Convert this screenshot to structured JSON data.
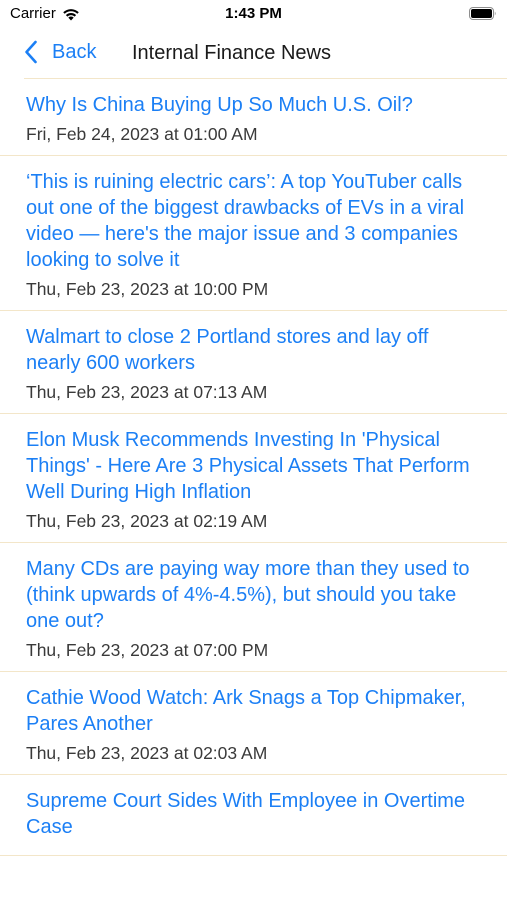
{
  "status_bar": {
    "carrier": "Carrier",
    "time": "1:43 PM"
  },
  "nav": {
    "back_label": "Back",
    "title": "Internal Finance News"
  },
  "colors": {
    "link": "#1b7ff5",
    "divider": "#f3e6c9"
  },
  "news": [
    {
      "title": "Why Is China Buying Up So Much U.S. Oil?",
      "date": "Fri, Feb 24, 2023 at 01:00 AM"
    },
    {
      "title": "‘This is ruining electric cars’: A top YouTuber calls out one of the biggest drawbacks of EVs in a viral video — here's the major issue and 3 companies looking to solve it",
      "date": "Thu, Feb 23, 2023 at 10:00 PM"
    },
    {
      "title": "Walmart to close 2 Portland stores and lay off nearly 600 workers",
      "date": "Thu, Feb 23, 2023 at 07:13 AM"
    },
    {
      "title": "Elon Musk Recommends Investing In 'Physical Things' - Here Are 3 Physical Assets That Perform Well During High Inflation",
      "date": "Thu, Feb 23, 2023 at 02:19 AM"
    },
    {
      "title": "Many CDs are paying way more than they used to (think upwards of 4%-4.5%), but should you take one out?",
      "date": "Thu, Feb 23, 2023 at 07:00 PM"
    },
    {
      "title": "Cathie Wood Watch: Ark Snags a Top Chipmaker, Pares Another",
      "date": "Thu, Feb 23, 2023 at 02:03 AM"
    },
    {
      "title": "Supreme Court Sides With Employee in Overtime Case",
      "date": ""
    }
  ]
}
